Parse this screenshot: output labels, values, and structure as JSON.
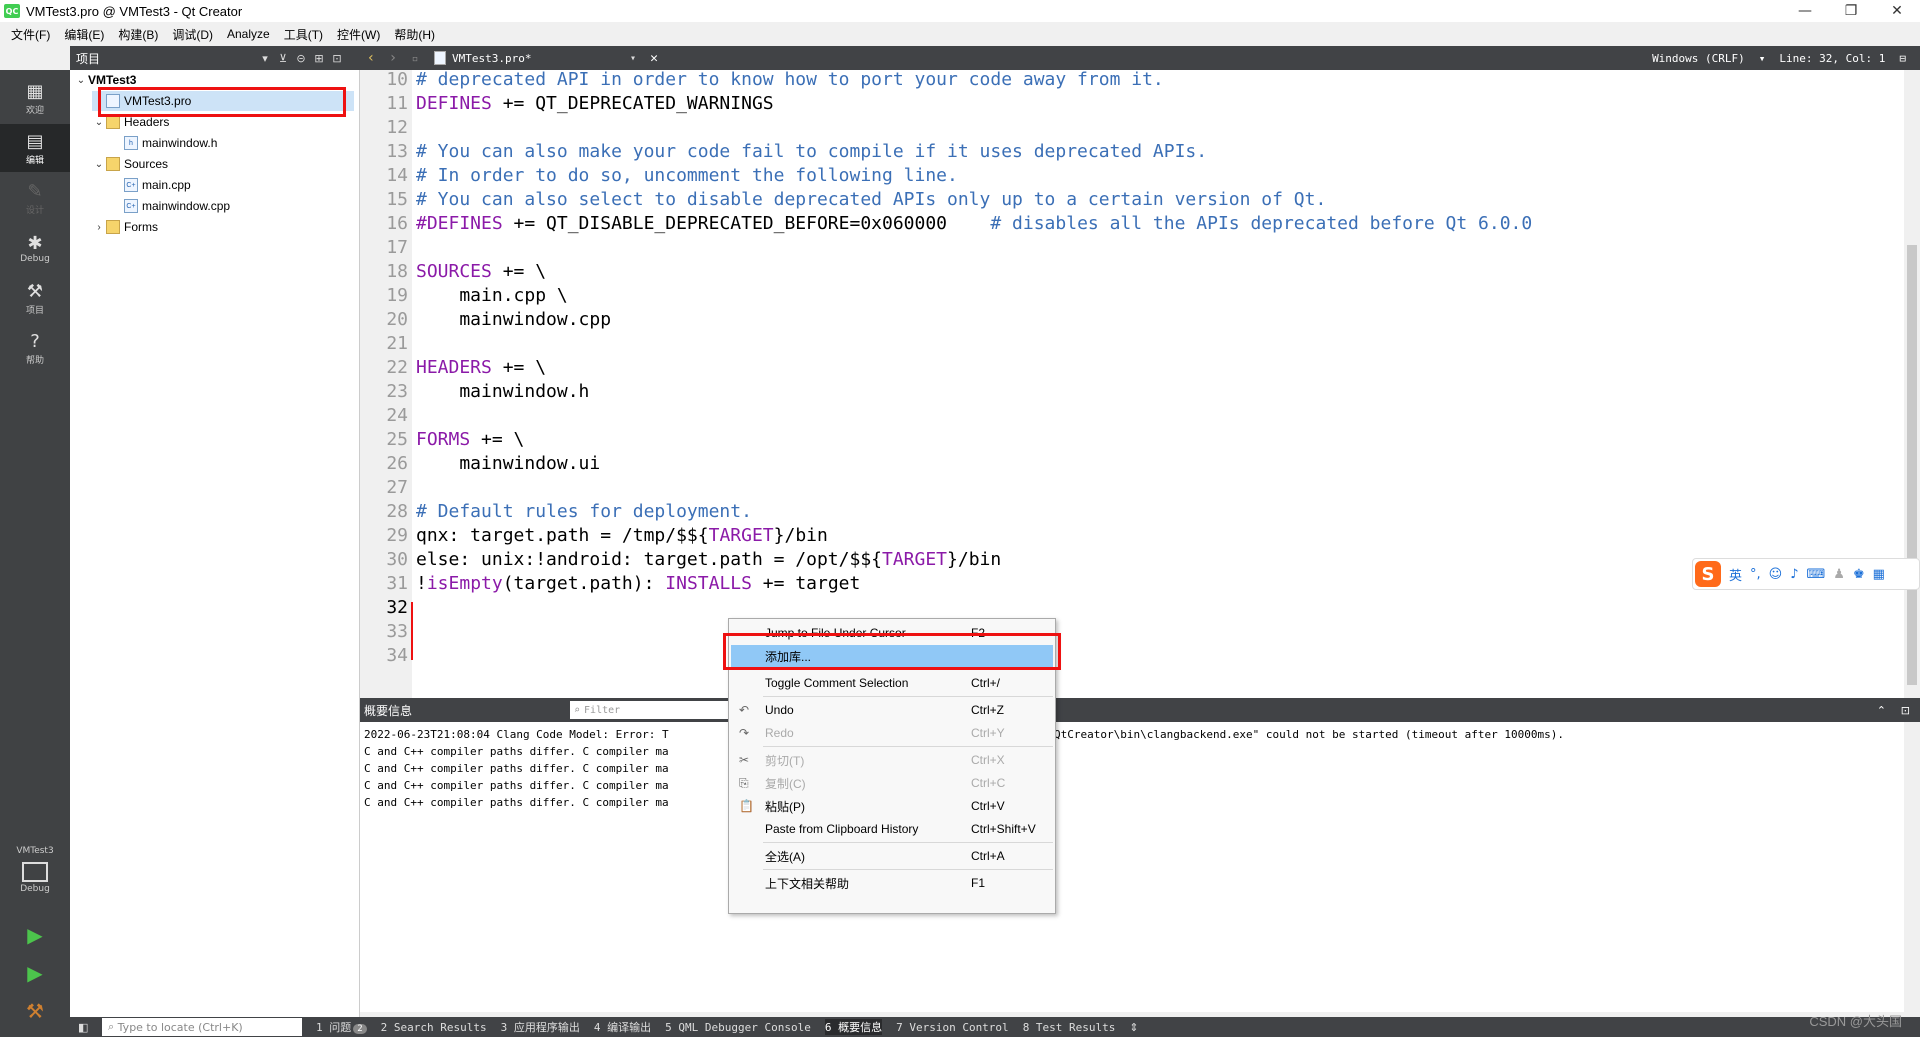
{
  "window": {
    "title": "VMTest3.pro @ VMTest3 - Qt Creator",
    "logo": "QC",
    "minimize": "—",
    "maximize": "❐",
    "close": "✕"
  },
  "menu": [
    "文件(F)",
    "编辑(E)",
    "构建(B)",
    "调试(D)",
    "Analyze",
    "工具(T)",
    "控件(W)",
    "帮助(H)"
  ],
  "modes": [
    {
      "label": "欢迎",
      "icon": "grid-icon"
    },
    {
      "label": "编辑",
      "icon": "edit-doc-icon"
    },
    {
      "label": "设计",
      "icon": "pencil-icon"
    },
    {
      "label": "Debug",
      "icon": "bug-icon"
    },
    {
      "label": "项目",
      "icon": "wrench-icon"
    },
    {
      "label": "帮助",
      "icon": "help-icon"
    }
  ],
  "kit": {
    "project": "VMTest3",
    "mode": "Debug"
  },
  "project_pane": {
    "title": "项目",
    "tree": [
      {
        "label": "VMTest3",
        "depth": 0,
        "expanded": true,
        "kind": "project"
      },
      {
        "label": "VMTest3.pro",
        "depth": 1,
        "kind": "pro",
        "selected": true
      },
      {
        "label": "Headers",
        "depth": 1,
        "expanded": true,
        "kind": "folder"
      },
      {
        "label": "mainwindow.h",
        "depth": 2,
        "kind": "h"
      },
      {
        "label": "Sources",
        "depth": 1,
        "expanded": true,
        "kind": "folder"
      },
      {
        "label": "main.cpp",
        "depth": 2,
        "kind": "cpp"
      },
      {
        "label": "mainwindow.cpp",
        "depth": 2,
        "kind": "cpp"
      },
      {
        "label": "Forms",
        "depth": 1,
        "expanded": false,
        "kind": "folder"
      }
    ]
  },
  "editor_toolbar": {
    "file": "VMTest3.pro*",
    "line_ending": "Windows (CRLF)",
    "position": "Line: 32, Col: 1"
  },
  "code": [
    {
      "n": "10",
      "parts": [
        [
          "c",
          "# deprecated API in order to know how to port your code away from it."
        ]
      ]
    },
    {
      "n": "11",
      "parts": [
        [
          "k",
          "DEFINES"
        ],
        [
          "p",
          " += QT_DEPRECATED_WARNINGS"
        ]
      ]
    },
    {
      "n": "12",
      "parts": []
    },
    {
      "n": "13",
      "parts": [
        [
          "c",
          "# You can also make your code fail to compile if it uses deprecated APIs."
        ]
      ]
    },
    {
      "n": "14",
      "parts": [
        [
          "c",
          "# In order to do so, uncomment the following line."
        ]
      ]
    },
    {
      "n": "15",
      "parts": [
        [
          "c",
          "# You can also select to disable deprecated APIs only up to a certain version of Qt."
        ]
      ]
    },
    {
      "n": "16",
      "parts": [
        [
          "k",
          "#DEFINES"
        ],
        [
          "p",
          " += QT_DISABLE_DEPRECATED_BEFORE=0x060000    "
        ],
        [
          "c",
          "# disables all the APIs deprecated before Qt 6.0.0"
        ]
      ]
    },
    {
      "n": "17",
      "parts": []
    },
    {
      "n": "18",
      "parts": [
        [
          "k",
          "SOURCES"
        ],
        [
          "p",
          " += \\"
        ]
      ]
    },
    {
      "n": "19",
      "parts": [
        [
          "p",
          "    main.cpp \\"
        ]
      ]
    },
    {
      "n": "20",
      "parts": [
        [
          "p",
          "    mainwindow.cpp"
        ]
      ]
    },
    {
      "n": "21",
      "parts": []
    },
    {
      "n": "22",
      "parts": [
        [
          "k",
          "HEADERS"
        ],
        [
          "p",
          " += \\"
        ]
      ]
    },
    {
      "n": "23",
      "parts": [
        [
          "p",
          "    mainwindow.h"
        ]
      ]
    },
    {
      "n": "24",
      "parts": []
    },
    {
      "n": "25",
      "parts": [
        [
          "k",
          "FORMS"
        ],
        [
          "p",
          " += \\"
        ]
      ]
    },
    {
      "n": "26",
      "parts": [
        [
          "p",
          "    mainwindow.ui"
        ]
      ]
    },
    {
      "n": "27",
      "parts": []
    },
    {
      "n": "28",
      "parts": [
        [
          "c",
          "# Default rules for deployment."
        ]
      ]
    },
    {
      "n": "29",
      "parts": [
        [
          "p",
          "qnx: target.path = /tmp/$${"
        ],
        [
          "k",
          "TARGET"
        ],
        [
          "p",
          "}/bin"
        ]
      ]
    },
    {
      "n": "30",
      "parts": [
        [
          "p",
          "else: unix:!android: target.path = /opt/$${"
        ],
        [
          "k",
          "TARGET"
        ],
        [
          "p",
          "}/bin"
        ]
      ]
    },
    {
      "n": "31",
      "parts": [
        [
          "p",
          "!"
        ],
        [
          "k",
          "isEmpty"
        ],
        [
          "p",
          "(target.path): "
        ],
        [
          "k",
          "INSTALLS"
        ],
        [
          "p",
          " += target"
        ]
      ]
    },
    {
      "n": "32",
      "parts": [],
      "current": true
    },
    {
      "n": "33",
      "parts": []
    },
    {
      "n": "34",
      "parts": []
    }
  ],
  "output_pane": {
    "title": "概要信息",
    "filter_placeholder": "Filter",
    "lines": [
      "2022-06-23T21:08:04 Clang Code Model: Error: T",
      "C and C++ compiler paths differ. C compiler ma",
      "C and C++ compiler paths differ. C compiler ma",
      "C and C++ compiler paths differ. C compiler ma",
      "C and C++ compiler paths differ. C compiler ma"
    ],
    "line1_tail": "QtCreator\\bin\\clangbackend.exe\" could not be started (timeout after 10000ms)."
  },
  "context_menu": [
    {
      "label": "Jump to File Under Cursor",
      "shortcut": "F2"
    },
    {
      "label": "添加库...",
      "shortcut": "",
      "highlighted": true
    },
    {
      "sep": true
    },
    {
      "label": "Toggle Comment Selection",
      "shortcut": "Ctrl+/"
    },
    {
      "sep": true
    },
    {
      "label": "Undo",
      "shortcut": "Ctrl+Z",
      "icon": "undo-icon"
    },
    {
      "label": "Redo",
      "shortcut": "Ctrl+Y",
      "disabled": true,
      "icon": "redo-icon"
    },
    {
      "sep": true
    },
    {
      "label": "剪切(T)",
      "shortcut": "Ctrl+X",
      "disabled": true,
      "icon": "cut-icon"
    },
    {
      "label": "复制(C)",
      "shortcut": "Ctrl+C",
      "disabled": true,
      "icon": "copy-icon"
    },
    {
      "label": "粘贴(P)",
      "shortcut": "Ctrl+V",
      "icon": "paste-icon"
    },
    {
      "label": "Paste from Clipboard History",
      "shortcut": "Ctrl+Shift+V"
    },
    {
      "sep": true
    },
    {
      "label": "全选(A)",
      "shortcut": "Ctrl+A"
    },
    {
      "sep": true
    },
    {
      "label": "上下文相关帮助",
      "shortcut": "F1"
    }
  ],
  "statusbar": {
    "locator_placeholder": "Type to locate (Ctrl+K)",
    "panes": [
      "1 问题",
      "2 Search Results",
      "3 应用程序输出",
      "4 编译输出",
      "5 QML Debugger Console",
      "6 概要信息",
      "7 Version Control",
      "8 Test Results"
    ],
    "issues_count": "2"
  },
  "ime": {
    "logo": "S",
    "lang": "英"
  },
  "watermark": "CSDN @大头国",
  "colors": {
    "highlight": "#90c8f6",
    "annotation": "#ee1111",
    "comment": "#3b6fb6",
    "keyword": "#8b1aa8",
    "dark_panel": "#414346"
  }
}
